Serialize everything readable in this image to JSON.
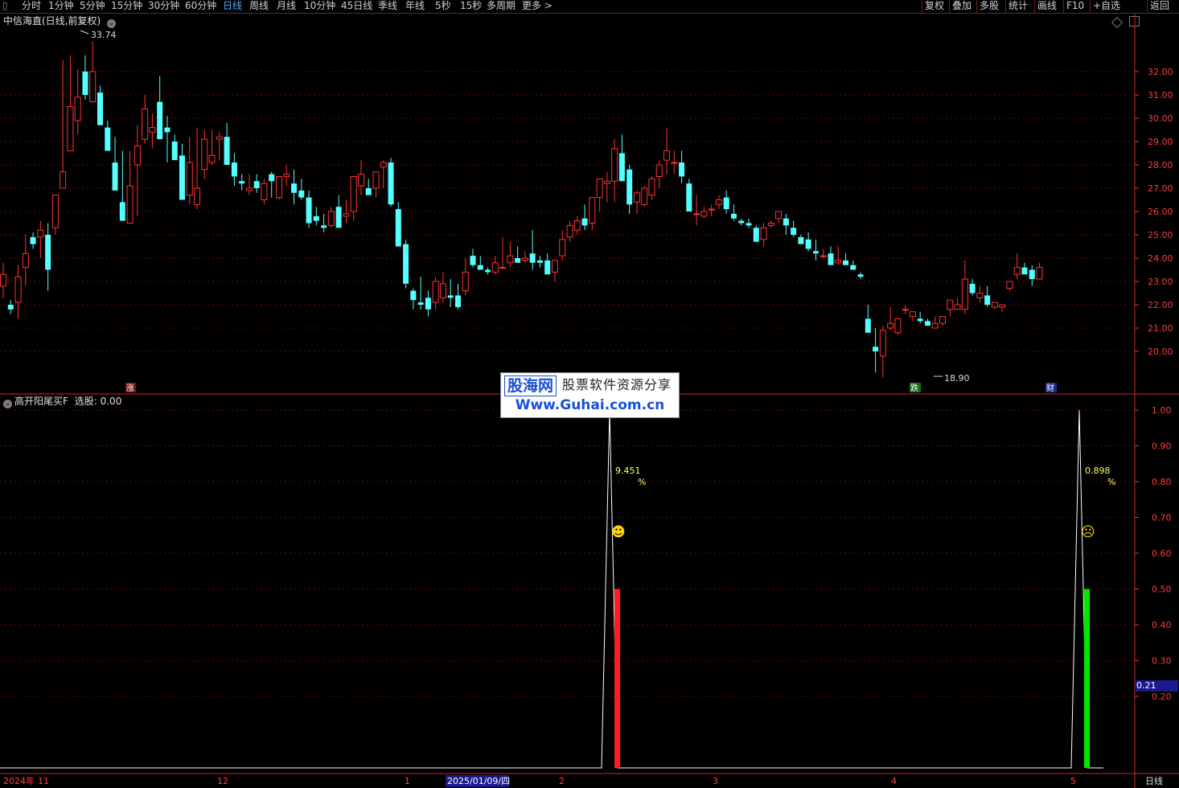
{
  "toolbar": {
    "left_items": [
      "分时",
      "1分钟",
      "5分钟",
      "15分钟",
      "30分钟",
      "60分钟",
      "日线",
      "周线",
      "月线",
      "10分钟",
      "45日线",
      "季线",
      "年线",
      "5秒",
      "15秒",
      "多周期",
      "更多 >"
    ],
    "active": "日线",
    "right_items": [
      "复权",
      "叠加",
      "多股",
      "统计",
      "画线",
      "F10",
      "+自选",
      "返回"
    ]
  },
  "main_chart": {
    "title": "中信海直(日线,前复权)",
    "y_ticks": [
      "32.00",
      "31.00",
      "30.00",
      "29.00",
      "28.00",
      "27.00",
      "26.00",
      "25.00",
      "24.00",
      "23.00",
      "22.00",
      "21.00",
      "20.00"
    ],
    "high_label": "33.74",
    "low_label": "18.90",
    "event_markers": [
      "涨",
      "跌",
      "财"
    ],
    "colors": {
      "up": "#ff3232",
      "down": "#54ffff",
      "grid": "#7a0000",
      "axis": "#ff3232",
      "text": "#ff3c3c"
    }
  },
  "indicator": {
    "title": "高开阳尾买F",
    "field": "选股",
    "value": "0.00",
    "y_ticks": [
      "1.00",
      "0.90",
      "0.80",
      "0.70",
      "0.60",
      "0.50",
      "0.40",
      "0.30",
      "0.20"
    ],
    "current_value": "0.21",
    "signals": [
      {
        "pct": "9.451",
        "unit": "%",
        "face": "☻",
        "bar_color": "#ff1e1e",
        "mood": "smile"
      },
      {
        "pct": "0.898",
        "unit": "%",
        "face": "☹",
        "bar_color": "#00e600",
        "mood": "frown"
      }
    ]
  },
  "time_axis": {
    "labels": [
      "2024年",
      "11",
      "12",
      "1",
      "2025/01/09/四",
      "2",
      "3",
      "4",
      "5"
    ],
    "period": "日线"
  },
  "watermark": {
    "brand": "股海网",
    "tagline": "股票软件资源分享",
    "url": "Www.Guhai.com.cn"
  },
  "chart_data": {
    "type": "candlestick",
    "title": "中信海直(日线,前复权)",
    "y_range": [
      19.0,
      33.74
    ],
    "high": 33.74,
    "low": 18.9,
    "candles": [
      [
        22.8,
        23.8,
        22.3,
        23.3
      ],
      [
        22.0,
        22.2,
        21.6,
        21.8
      ],
      [
        22.1,
        23.7,
        21.4,
        23.2
      ],
      [
        23.6,
        25.0,
        22.8,
        24.2
      ],
      [
        24.9,
        25.1,
        24.4,
        24.6
      ],
      [
        24.9,
        25.6,
        24.0,
        25.2
      ],
      [
        25.0,
        25.5,
        22.6,
        23.5
      ],
      [
        25.3,
        26.6,
        25.0,
        26.7
      ],
      [
        27.0,
        32.5,
        27.2,
        27.7
      ],
      [
        28.6,
        32.7,
        28.6,
        30.5
      ],
      [
        29.9,
        32.1,
        29.3,
        30.9
      ],
      [
        32.0,
        32.7,
        30.8,
        31.0
      ],
      [
        30.7,
        33.3,
        31.0,
        32.0
      ],
      [
        31.1,
        31.4,
        30.6,
        29.7
      ],
      [
        29.6,
        29.9,
        29.0,
        28.6
      ],
      [
        28.1,
        29.2,
        27.0,
        26.9
      ],
      [
        26.4,
        28.6,
        25.7,
        25.6
      ],
      [
        25.5,
        28.6,
        25.6,
        27.1
      ],
      [
        28.0,
        29.7,
        25.8,
        28.8
      ],
      [
        29.1,
        31.0,
        28.9,
        30.4
      ],
      [
        29.4,
        30.2,
        28.7,
        29.6
      ],
      [
        30.7,
        31.8,
        30.0,
        29.1
      ],
      [
        29.6,
        30.1,
        28.1,
        29.4
      ],
      [
        29.0,
        29.3,
        28.4,
        28.2
      ],
      [
        28.4,
        28.9,
        26.8,
        26.5
      ],
      [
        26.7,
        29.2,
        26.3,
        28.1
      ],
      [
        26.3,
        29.6,
        26.1,
        27.0
      ],
      [
        27.8,
        29.5,
        27.4,
        29.1
      ],
      [
        28.1,
        29.5,
        28.0,
        28.4
      ],
      [
        29.1,
        29.4,
        28.2,
        29.2
      ],
      [
        29.2,
        29.8,
        28.1,
        28.0
      ],
      [
        28.1,
        28.5,
        27.1,
        27.5
      ],
      [
        27.3,
        27.6,
        26.9,
        27.2
      ],
      [
        26.9,
        27.6,
        26.7,
        27.0
      ],
      [
        27.3,
        27.6,
        26.8,
        27.0
      ],
      [
        26.5,
        27.4,
        26.3,
        27.2
      ],
      [
        27.6,
        27.7,
        26.6,
        27.3
      ],
      [
        26.6,
        27.5,
        26.5,
        27.5
      ],
      [
        27.5,
        28.0,
        27.1,
        27.6
      ],
      [
        27.2,
        27.8,
        26.3,
        26.8
      ],
      [
        26.9,
        27.4,
        26.5,
        26.6
      ],
      [
        26.6,
        26.9,
        25.3,
        25.5
      ],
      [
        25.8,
        26.2,
        25.4,
        25.6
      ],
      [
        25.4,
        25.9,
        25.1,
        25.3
      ],
      [
        25.4,
        26.2,
        25.3,
        26.0
      ],
      [
        26.2,
        26.7,
        25.4,
        25.3
      ],
      [
        25.8,
        26.5,
        25.5,
        25.9
      ],
      [
        26.0,
        27.2,
        25.6,
        27.5
      ],
      [
        27.1,
        28.2,
        26.7,
        27.6
      ],
      [
        27.0,
        27.4,
        26.9,
        26.7
      ],
      [
        27.0,
        27.6,
        26.6,
        27.7
      ],
      [
        27.9,
        28.2,
        27.0,
        28.1
      ],
      [
        28.1,
        28.3,
        26.2,
        26.3
      ],
      [
        26.1,
        26.4,
        24.6,
        24.5
      ],
      [
        24.6,
        24.8,
        22.7,
        22.9
      ],
      [
        22.6,
        22.7,
        21.8,
        22.2
      ],
      [
        22.1,
        23.2,
        21.8,
        22.0
      ],
      [
        22.3,
        22.6,
        21.5,
        21.8
      ],
      [
        22.1,
        23.2,
        21.8,
        23.0
      ],
      [
        22.3,
        23.4,
        22.1,
        22.9
      ],
      [
        22.4,
        23.1,
        21.9,
        22.3
      ],
      [
        22.4,
        22.9,
        21.8,
        21.9
      ],
      [
        22.6,
        24.0,
        22.4,
        23.4
      ],
      [
        24.1,
        24.4,
        23.6,
        23.7
      ],
      [
        23.7,
        24.1,
        23.6,
        23.5
      ],
      [
        23.5,
        23.6,
        23.3,
        23.4
      ],
      [
        23.4,
        24.1,
        23.3,
        23.8
      ],
      [
        23.6,
        24.9,
        23.6,
        23.6
      ],
      [
        23.8,
        24.7,
        23.6,
        24.1
      ],
      [
        24.0,
        24.5,
        23.9,
        23.8
      ],
      [
        23.9,
        24.3,
        23.8,
        24.0
      ],
      [
        24.2,
        25.2,
        23.5,
        23.8
      ],
      [
        23.9,
        24.1,
        23.6,
        23.8
      ],
      [
        23.9,
        24.2,
        23.4,
        23.3
      ],
      [
        23.4,
        23.9,
        23.0,
        23.9
      ],
      [
        24.1,
        25.2,
        23.9,
        24.8
      ],
      [
        24.9,
        25.6,
        24.7,
        25.4
      ],
      [
        25.2,
        25.8,
        25.0,
        25.6
      ],
      [
        25.7,
        26.3,
        25.2,
        25.4
      ],
      [
        25.5,
        26.6,
        25.2,
        26.6
      ],
      [
        26.6,
        27.3,
        26.0,
        27.4
      ],
      [
        27.2,
        27.7,
        26.4,
        27.3
      ],
      [
        27.3,
        29.1,
        26.4,
        28.7
      ],
      [
        28.5,
        29.3,
        28.0,
        27.3
      ],
      [
        27.8,
        28.0,
        25.9,
        26.3
      ],
      [
        26.4,
        26.9,
        25.9,
        26.8
      ],
      [
        26.3,
        27.1,
        26.2,
        27.0
      ],
      [
        26.7,
        27.5,
        26.5,
        27.4
      ],
      [
        27.5,
        28.2,
        27.0,
        28.0
      ],
      [
        28.2,
        29.6,
        27.6,
        28.6
      ],
      [
        28.1,
        28.6,
        27.6,
        28.1
      ],
      [
        28.1,
        28.6,
        27.2,
        27.5
      ],
      [
        27.2,
        27.4,
        26.3,
        26.0
      ],
      [
        25.9,
        26.7,
        25.4,
        25.9
      ],
      [
        25.8,
        26.2,
        25.7,
        26.0
      ],
      [
        26.1,
        26.3,
        25.8,
        26.1
      ],
      [
        26.3,
        26.7,
        26.1,
        26.5
      ],
      [
        26.6,
        26.9,
        25.9,
        26.1
      ],
      [
        25.9,
        26.3,
        25.6,
        25.7
      ],
      [
        25.6,
        25.7,
        25.4,
        25.5
      ],
      [
        25.5,
        25.7,
        25.3,
        25.4
      ],
      [
        25.3,
        25.4,
        24.7,
        24.7
      ],
      [
        24.8,
        25.5,
        24.5,
        25.3
      ],
      [
        25.4,
        25.6,
        25.3,
        25.5
      ],
      [
        25.7,
        26.0,
        25.5,
        26.0
      ],
      [
        25.7,
        25.9,
        25.0,
        25.4
      ],
      [
        25.3,
        25.6,
        24.9,
        25.0
      ],
      [
        24.9,
        25.0,
        24.6,
        24.6
      ],
      [
        24.8,
        25.1,
        24.3,
        24.4
      ],
      [
        24.3,
        24.8,
        23.9,
        24.2
      ],
      [
        24.1,
        24.4,
        24.0,
        24.1
      ],
      [
        24.2,
        24.5,
        23.8,
        23.7
      ],
      [
        23.8,
        24.5,
        23.7,
        23.9
      ],
      [
        23.9,
        24.2,
        23.7,
        23.7
      ],
      [
        23.7,
        23.9,
        23.5,
        23.5
      ],
      [
        23.3,
        23.4,
        23.1,
        23.2
      ],
      [
        21.4,
        22.0,
        21.1,
        20.8
      ],
      [
        20.2,
        21.0,
        19.1,
        20.0
      ],
      [
        19.8,
        21.1,
        18.9,
        20.9
      ],
      [
        21.0,
        21.9,
        20.9,
        21.2
      ],
      [
        20.8,
        21.4,
        20.7,
        21.4
      ],
      [
        21.8,
        22.0,
        21.6,
        21.8
      ],
      [
        21.5,
        21.7,
        21.3,
        21.7
      ],
      [
        21.4,
        21.7,
        21.2,
        21.3
      ],
      [
        21.3,
        21.4,
        21.1,
        21.1
      ],
      [
        21.0,
        21.5,
        21.1,
        21.2
      ],
      [
        21.2,
        21.5,
        21.1,
        21.5
      ],
      [
        21.8,
        22.2,
        21.5,
        22.2
      ],
      [
        21.8,
        22.3,
        21.8,
        22.0
      ],
      [
        21.8,
        23.9,
        21.6,
        23.1
      ],
      [
        22.9,
        23.1,
        22.4,
        22.5
      ],
      [
        22.3,
        22.8,
        22.1,
        22.5
      ],
      [
        22.4,
        22.8,
        21.9,
        22.0
      ],
      [
        21.9,
        22.1,
        21.8,
        22.1
      ],
      [
        21.9,
        22.0,
        21.7,
        22.0
      ],
      [
        22.7,
        23.0,
        22.6,
        23.0
      ],
      [
        23.3,
        24.2,
        23.1,
        23.6
      ],
      [
        23.6,
        23.8,
        23.4,
        23.3
      ],
      [
        23.5,
        23.7,
        22.8,
        23.1
      ],
      [
        23.1,
        23.8,
        23.1,
        23.6
      ]
    ],
    "series": [
      {
        "name": "高开阳尾买F",
        "values": [
          0.0,
          1.0,
          0.0,
          1.0,
          0.0
        ]
      },
      {
        "name": "选股",
        "values": [
          0.0,
          0.5,
          0.0,
          0.5,
          0.0
        ]
      }
    ]
  }
}
